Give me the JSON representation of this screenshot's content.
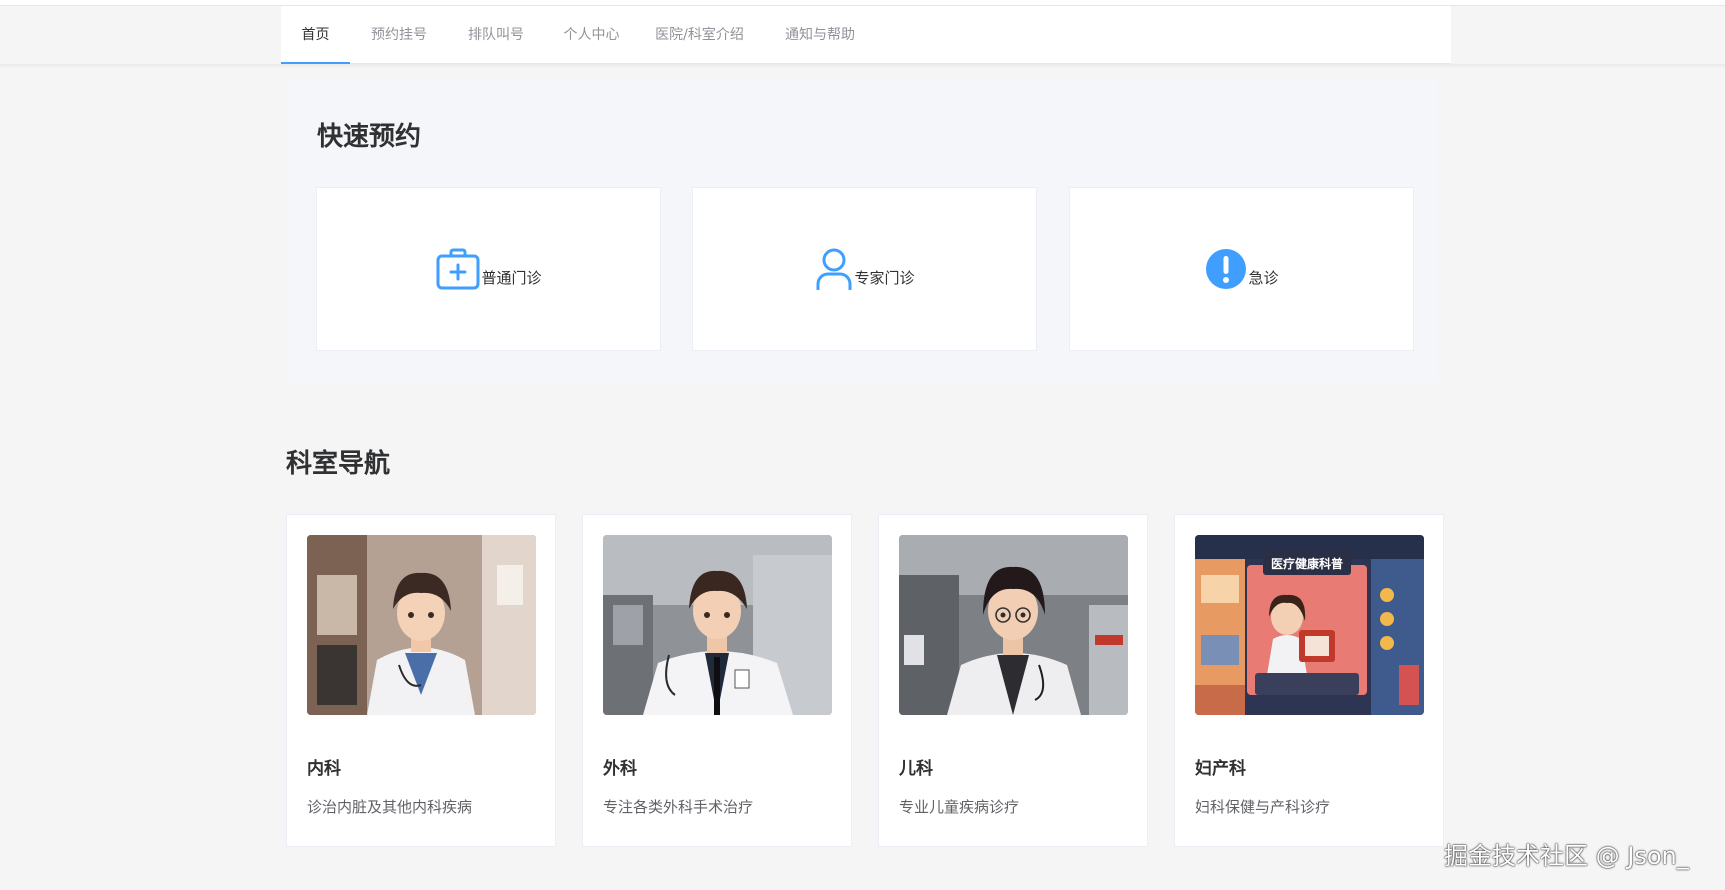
{
  "nav": {
    "tabs": [
      {
        "label": "首页",
        "active": true
      },
      {
        "label": "预约挂号"
      },
      {
        "label": "排队叫号"
      },
      {
        "label": "个人中心"
      },
      {
        "label": "医院/科室介绍"
      },
      {
        "label": "通知与帮助"
      }
    ]
  },
  "quick": {
    "title": "快速预约",
    "items": [
      {
        "label": "普通门诊",
        "icon": "first-aid-kit-icon"
      },
      {
        "label": "专家门诊",
        "icon": "user-icon"
      },
      {
        "label": "急诊",
        "icon": "warning-icon"
      }
    ]
  },
  "departments": {
    "title": "科室导航",
    "items": [
      {
        "name": "内科",
        "desc": "诊治内脏及其他内科疾病"
      },
      {
        "name": "外科",
        "desc": "专注各类外科手术治疗"
      },
      {
        "name": "儿科",
        "desc": "专业儿童疾病诊疗"
      },
      {
        "name": "妇产科",
        "desc": "妇科保健与产科诊疗",
        "poster_title": "医疗健康科普"
      }
    ]
  },
  "watermark": "掘金技术社区 @ Json_",
  "colors": {
    "primary": "#409eff",
    "text": "#303133",
    "secondary_text": "#606266",
    "muted_text": "#909399",
    "page_bg": "#f5f5f5",
    "panel_bg": "#f4f6f9"
  }
}
